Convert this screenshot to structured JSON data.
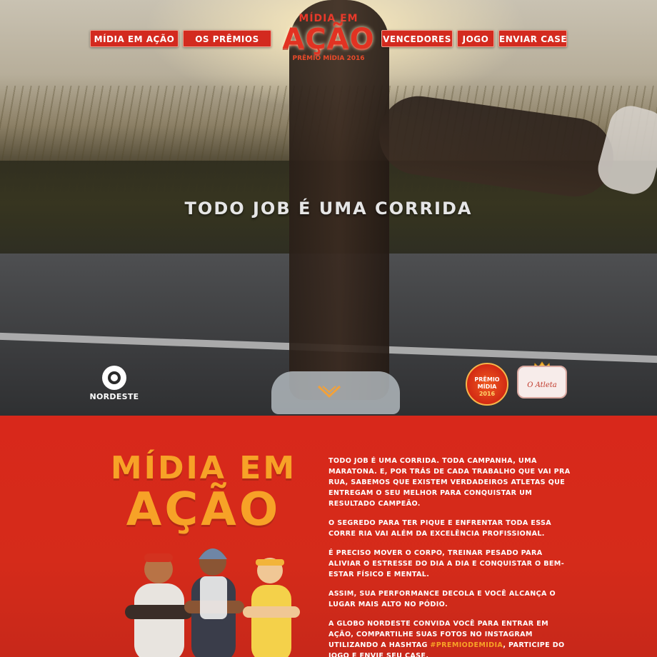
{
  "nav": {
    "items": [
      "MÍDIA EM AÇÃO",
      "OS PRÊMIOS",
      "VENCEDORES",
      "JOGO",
      "ENVIAR CASE"
    ]
  },
  "brand": {
    "line1": "MÍDIA EM",
    "line2": "AÇÃO",
    "line3": "PRÊMIO MÍDIA 2016"
  },
  "hero": {
    "headline": "TODO JOB É UMA CORRIDA"
  },
  "footer_logos": {
    "globo_label": "NORDESTE",
    "premio_label": "PRÊMIO MÍDIA",
    "premio_year": "2016",
    "atleta_label": "O Atleta"
  },
  "lower": {
    "title_line1": "MÍDIA EM",
    "title_line2": "AÇÃO",
    "paragraphs": [
      "TODO JOB É UMA CORRIDA. TODA CAMPANHA, UMA MARATONA. E, POR TRÁS DE CADA TRABALHO QUE VAI PRA RUA, SABEMOS QUE EXISTEM VERDADEIROS ATLETAS QUE ENTREGAM O SEU MELHOR PARA CONQUISTAR UM RESULTADO CAMPEÃO.",
      "O SEGREDO PARA TER PIQUE E ENFRENTAR TODA ESSA CORRE RIA VAI ALÉM DA EXCELÊNCIA PROFISSIONAL.",
      "É PRECISO MOVER O CORPO, TREINAR PESADO PARA ALIVIAR O ESTRESSE DO DIA A DIA E CONQUISTAR O BEM-ESTAR FÍSICO E MENTAL.",
      "ASSIM, SUA PERFORMANCE DECOLA E VOCÊ ALCANÇA O LUGAR MAIS ALTO NO PÓDIO."
    ],
    "last_paragraph_before": "A GLOBO NORDESTE CONVIDA VOCÊ PARA ENTRAR EM AÇÃO, COMPARTILHE SUAS FOTOS NO INSTAGRAM UTILIZANDO A HASHTAG ",
    "hashtag": "#PREMIODEMIDIA",
    "last_paragraph_after": ", PARTICIPE DO JOGO E ENVIE SEU CASE."
  },
  "colors": {
    "brand_red": "#d32a1f",
    "accent_orange": "#f7a227"
  },
  "icons": [
    "globo-icon",
    "chevron-down-icon",
    "crown-icon"
  ]
}
